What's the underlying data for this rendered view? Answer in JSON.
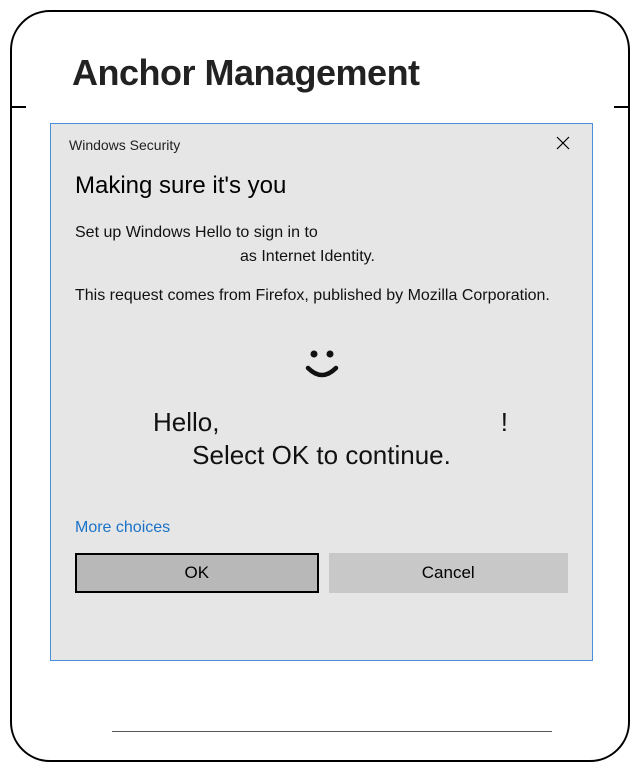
{
  "page": {
    "title": "Anchor Management"
  },
  "dialog": {
    "windowTitle": "Windows Security",
    "heading": "Making sure it's you",
    "line1": "Set up Windows Hello to sign in to",
    "line1b": "as Internet Identity.",
    "line2": "This request comes from Firefox, published by Mozilla Corporation.",
    "helloPrefix": "Hello,",
    "helloSuffix": "!",
    "selectOk": "Select OK to continue.",
    "moreChoices": "More choices",
    "okLabel": "OK",
    "cancelLabel": "Cancel"
  }
}
